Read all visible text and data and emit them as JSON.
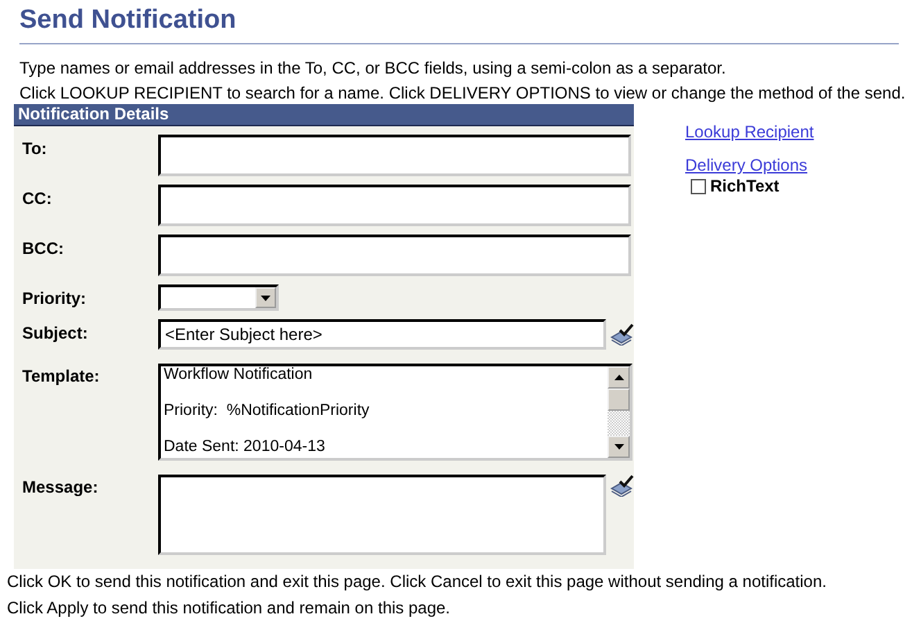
{
  "title": "Send Notification",
  "instructions": [
    "Type names or email addresses in the To, CC, or BCC fields, using a semi-colon as a separator.",
    "Click LOOKUP RECIPIENT to search for a name.  Click DELIVERY OPTIONS to view or change the method of the send."
  ],
  "panel": {
    "header": "Notification Details",
    "fields": [
      {
        "kind": "text",
        "label": "To:"
      },
      {
        "kind": "text",
        "label": "CC:"
      },
      {
        "kind": "text",
        "label": "BCC:"
      },
      {
        "kind": "dropdown",
        "label": "Priority:"
      },
      {
        "kind": "subject",
        "label": "Subject:",
        "value": "<Enter Subject here>"
      },
      {
        "kind": "template",
        "label": "Template:",
        "value": "Workflow Notification\n\nPriority:  %NotificationPriority\n\nDate Sent: 2010-04-13"
      },
      {
        "kind": "message",
        "label": "Message:"
      }
    ]
  },
  "links": [
    "Lookup Recipient",
    "Delivery Options"
  ],
  "rich_text": {
    "label": "RichText",
    "checked": false
  },
  "footer": [
    "Click OK to send this notification and exit this page.  Click Cancel to exit this page without sending a notification.",
    "Click Apply to send this notification and remain on this page."
  ]
}
